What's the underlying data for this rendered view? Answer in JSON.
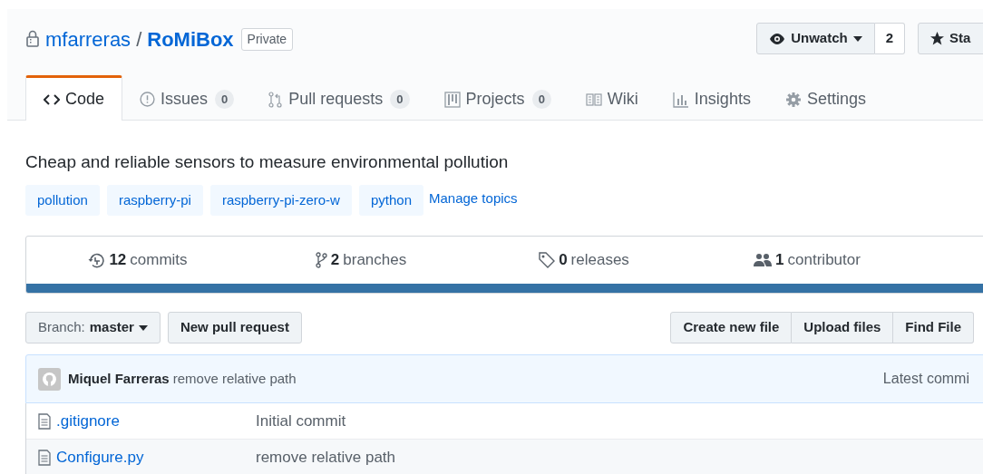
{
  "repo": {
    "owner": "mfarreras",
    "separator": "/",
    "name": "RoMiBox",
    "visibility": "Private"
  },
  "actions": [
    {
      "kind": "watch",
      "label": "Unwatch",
      "count": "2"
    },
    {
      "kind": "star",
      "label": "Sta"
    }
  ],
  "tabs": [
    {
      "label": "Code",
      "selected": true
    },
    {
      "label": "Issues",
      "count": "0",
      "selected": false
    },
    {
      "label": "Pull requests",
      "count": "0",
      "selected": false
    },
    {
      "label": "Projects",
      "count": "0",
      "selected": false
    },
    {
      "label": "Wiki",
      "selected": false
    },
    {
      "label": "Insights",
      "selected": false
    },
    {
      "label": "Settings",
      "selected": false
    }
  ],
  "description": "Cheap and reliable sensors to measure environmental pollution",
  "topics": [
    "pollution",
    "raspberry-pi",
    "raspberry-pi-zero-w",
    "python"
  ],
  "manage_topics": "Manage topics",
  "stats": [
    {
      "count": "12",
      "label": "commits"
    },
    {
      "count": "2",
      "label": "branches"
    },
    {
      "count": "0",
      "label": "releases"
    },
    {
      "count": "1",
      "label": "contributor"
    }
  ],
  "branch": {
    "label": "Branch:",
    "value": "master"
  },
  "new_pull_request": "New pull request",
  "file_buttons": [
    "Create new file",
    "Upload files",
    "Find File"
  ],
  "latest_commit": {
    "author": "Miquel Farreras",
    "message": "remove relative path",
    "label": "Latest commi"
  },
  "files": [
    {
      "name": ".gitignore",
      "message": "Initial commit"
    },
    {
      "name": "Configure.py",
      "message": "remove relative path"
    }
  ]
}
